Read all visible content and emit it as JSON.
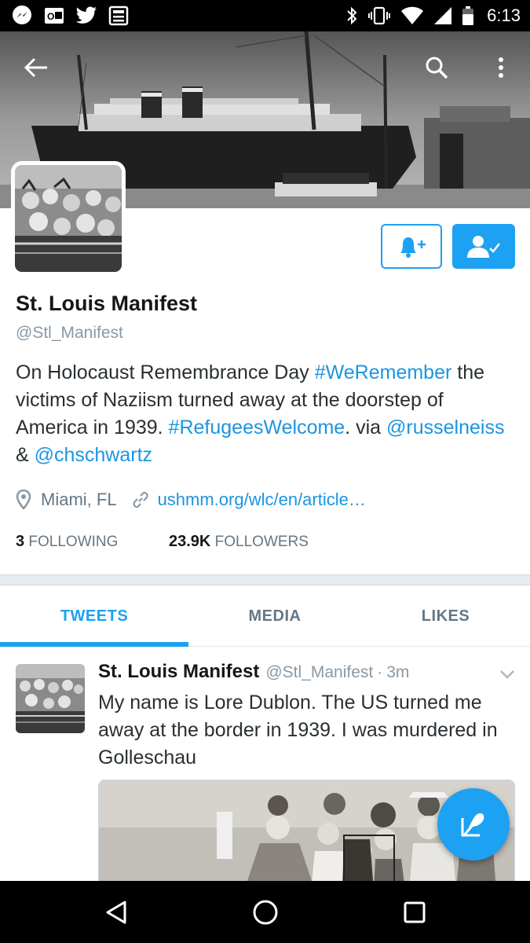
{
  "status_bar": {
    "time": "6:13",
    "left_icons": [
      "messenger-icon",
      "outlook-icon",
      "twitter-icon",
      "news-icon"
    ],
    "right_icons": [
      "bluetooth-icon",
      "vibrate-icon",
      "wifi-icon",
      "signal-icon",
      "battery-icon"
    ]
  },
  "header": {
    "back_icon": "arrow-left-icon",
    "search_icon": "search-icon",
    "menu_icon": "more-vertical-icon"
  },
  "profile": {
    "display_name": "St. Louis Manifest",
    "handle": "@Stl_Manifest",
    "bio": {
      "part1": "On Holocaust Remembrance Day ",
      "tag1": "#WeRemember",
      "part2": " the victims of Naziism turned away at the doorstep of America in 1939. ",
      "tag2": "#RefugeesWelcome",
      "part3": ". via ",
      "mention1": "@russelneiss",
      "part4": " & ",
      "mention2": "@chschwartz"
    },
    "location": "Miami, FL",
    "url": "ushmm.org/wlc/en/article…",
    "following_count": "3",
    "following_label": "FOLLOWING",
    "followers_count": "23.9K",
    "followers_label": "FOLLOWERS"
  },
  "tabs": [
    {
      "label": "TWEETS",
      "active": true
    },
    {
      "label": "MEDIA",
      "active": false
    },
    {
      "label": "LIKES",
      "active": false
    }
  ],
  "tweet": {
    "name": "St. Louis Manifest",
    "handle": "@Stl_Manifest",
    "separator": "·",
    "time": "3m",
    "text": "My name is Lore Dublon. The US turned me away at the border in 1939. I was murdered in Golleschau"
  },
  "colors": {
    "accent": "#1da1f2",
    "link": "#1b95e0",
    "muted": "#657786"
  }
}
